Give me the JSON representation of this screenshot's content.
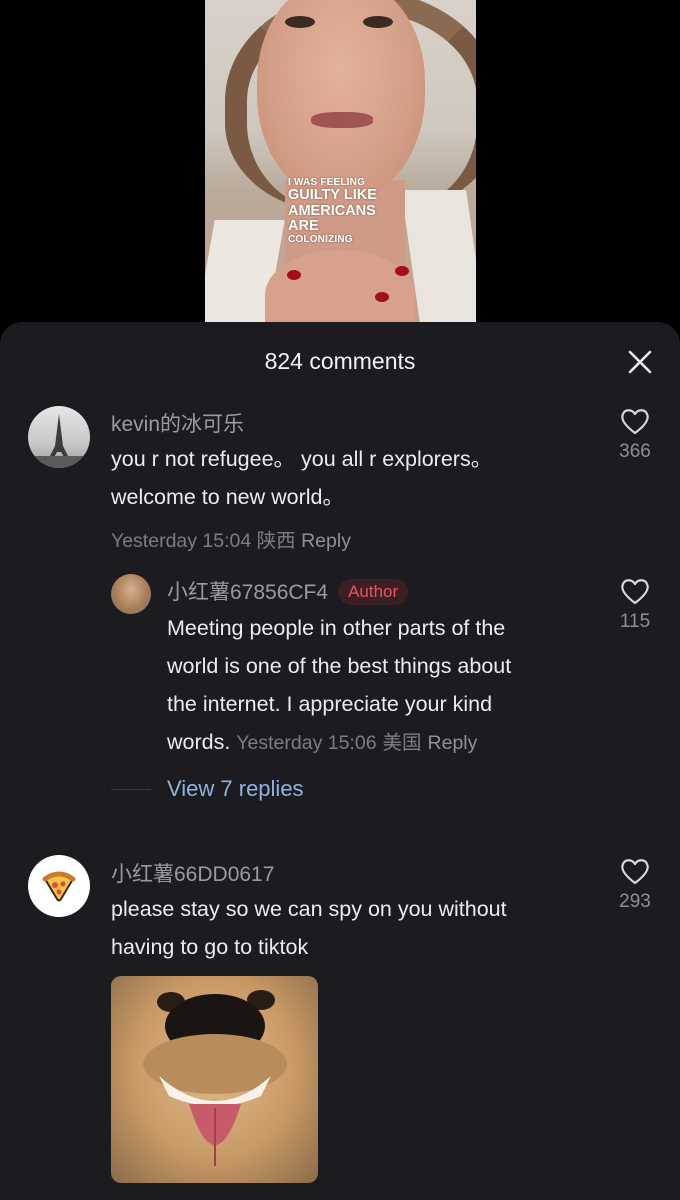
{
  "video": {
    "caption_lines": [
      "I WAS FEELING",
      "GUILTY LIKE",
      "AMERICANS",
      "ARE",
      "COLONIZING"
    ]
  },
  "sheet": {
    "title": "824 comments",
    "close_icon": "close-icon"
  },
  "comments": [
    {
      "username": "kevin的冰可乐",
      "text_lines": [
        "you r not refugee。 you all r explorers。",
        "welcome to new world。"
      ],
      "time": "Yesterday 15:04",
      "location": "陕西",
      "reply_label": "Reply",
      "likes": "366",
      "avatar_icon": "eiffel-tower-avatar"
    },
    {
      "username": "小红薯67856CF4",
      "badge": "Author",
      "text_lines": [
        "Meeting people in other parts of the",
        "world is one of the best things about",
        "the internet. I appreciate your kind",
        "words."
      ],
      "time": "Yesterday 15:06",
      "location": "美国",
      "reply_label": "Reply",
      "likes": "115",
      "avatar_icon": "author-avatar"
    },
    {
      "username": "小红薯66DD0617",
      "text_lines": [
        "please stay so we can spy on you without",
        "having to go to tiktok"
      ],
      "likes": "293",
      "avatar_icon": "pizza-icon",
      "image": "dog-photo"
    }
  ],
  "view_replies_label": "View 7 replies",
  "colors": {
    "sheet_bg": "#1c1c20",
    "author_badge_text": "#f0525d",
    "link_blue": "#8fb3e0"
  }
}
